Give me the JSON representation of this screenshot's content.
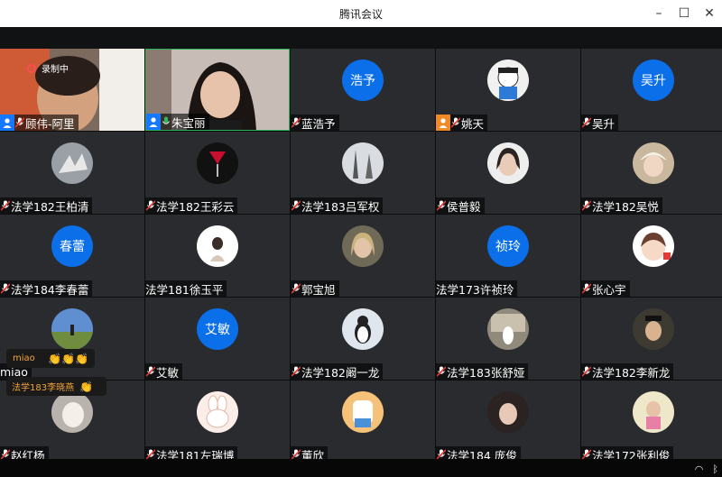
{
  "window": {
    "title": "腾讯会议"
  },
  "recording": {
    "label": "录制中"
  },
  "tiles": [
    {
      "name": "顾伟-阿里",
      "host": true,
      "hostColor": "#1677ff"
    },
    {
      "name": "朱宝丽",
      "host": true,
      "hostColor": "#1677ff"
    },
    {
      "name": "蓝浩予",
      "avatarText": "浩予"
    },
    {
      "name": "姚天",
      "host": true,
      "hostColor": "#f08a24"
    },
    {
      "name": "吴升",
      "avatarText": "吴升"
    },
    {
      "name": "法学182王柏清"
    },
    {
      "name": "法学182王彩云"
    },
    {
      "name": "法学183吕军权"
    },
    {
      "name": "侯普毅"
    },
    {
      "name": "法学182吴悦"
    },
    {
      "name": "法学184李春蕾",
      "avatarText": "春蕾"
    },
    {
      "name": "法学181徐玉平"
    },
    {
      "name": "郭宝旭"
    },
    {
      "name": "法学173许祯玲",
      "avatarText": "祯玲"
    },
    {
      "name": "张心宇"
    },
    {
      "name": "miao"
    },
    {
      "name": "艾敏",
      "avatarText": "艾敏"
    },
    {
      "name": "法学182阚一龙"
    },
    {
      "name": "法学183张舒娅"
    },
    {
      "name": "法学182李新龙"
    },
    {
      "name": "赵红杨"
    },
    {
      "name": "法学181左瑞博"
    },
    {
      "name": "董欣"
    },
    {
      "name": "法学184 庞俊"
    },
    {
      "name": "法学172张利俊"
    }
  ],
  "reactions": [
    {
      "sender": "miao",
      "emoji": "👏👏👏"
    },
    {
      "sender": "法学183李晓燕",
      "emoji": "👏"
    }
  ],
  "colors": {
    "accent": "#0a6fe8",
    "hostBadge": "#1677ff",
    "reaction": "#f3a43a"
  }
}
